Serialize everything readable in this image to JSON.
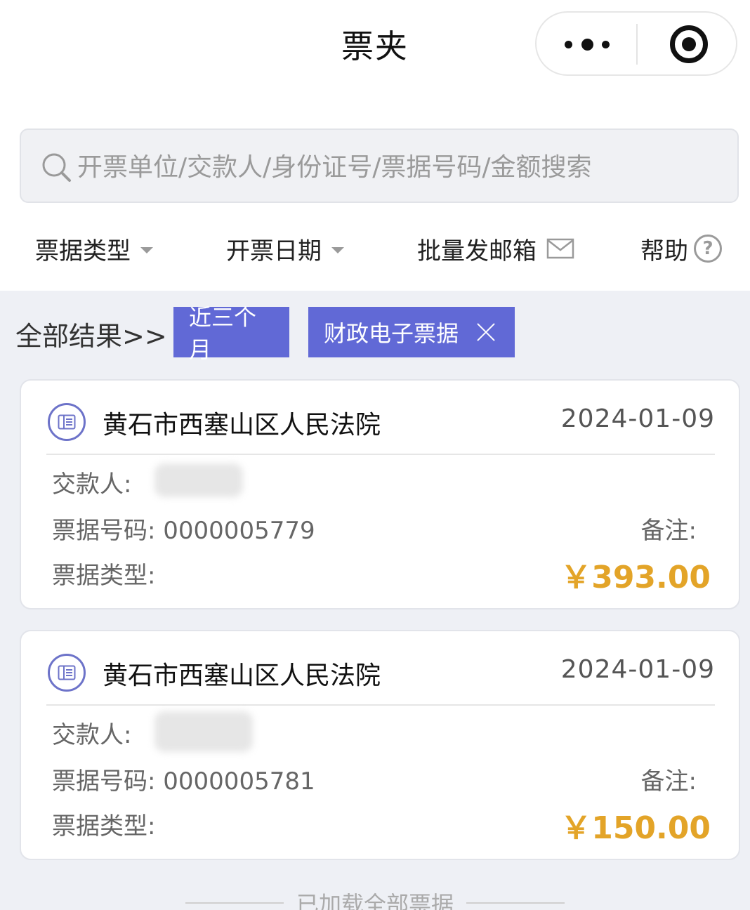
{
  "nav": {
    "title": "票夹"
  },
  "search": {
    "placeholder": "开票单位/交款人/身份证号/票据号码/金额搜索",
    "value": ""
  },
  "filters": {
    "type_label": "票据类型",
    "date_label": "开票日期",
    "batch_label": "批量发邮箱",
    "help_label": "帮助",
    "help_glyph": "?"
  },
  "results": {
    "all_label": "全部结果>>",
    "chips": [
      "近三个月",
      "财政电子票据"
    ]
  },
  "labels": {
    "payer": "交款人:",
    "number": "票据号码:",
    "type": "票据类型:",
    "remark": "备注:"
  },
  "tickets": [
    {
      "org": "黄石市西塞山区人民法院",
      "date": "2024-01-09",
      "number": "0000005779",
      "amount": "￥393.00"
    },
    {
      "org": "黄石市西塞山区人民法院",
      "date": "2024-01-09",
      "number": "0000005781",
      "amount": "￥150.00"
    }
  ],
  "footer": {
    "loaded": "已加载全部票据"
  },
  "colors": {
    "accent": "#6169d6",
    "amount": "#e3a428"
  }
}
